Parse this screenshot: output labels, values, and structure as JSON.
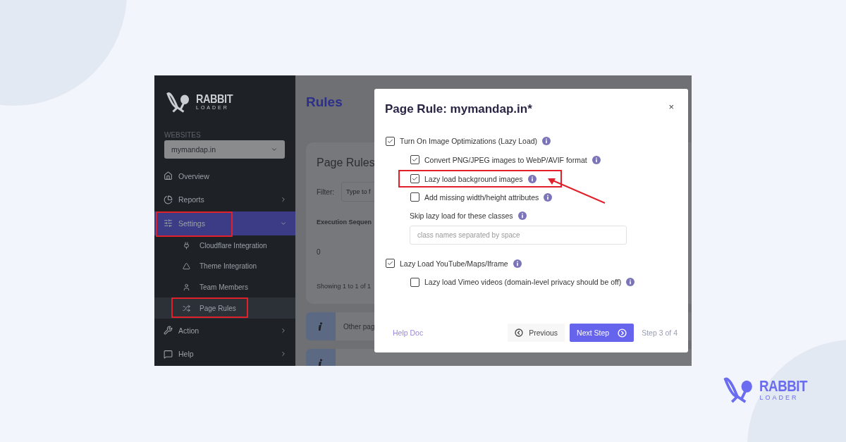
{
  "sidebar": {
    "logo": {
      "name": "RABBIT",
      "tagline": "LOADER"
    },
    "websites_label": "WEBSITES",
    "website_select": "mymandap.in",
    "items": [
      {
        "kind": "home",
        "label": "Overview",
        "selected": false,
        "highlighted": false,
        "has_submenu": false
      },
      {
        "kind": "reports",
        "label": "Reports",
        "selected": false,
        "highlighted": false,
        "has_submenu": true,
        "expanded": false
      },
      {
        "kind": "settings",
        "label": "Settings",
        "selected": true,
        "highlighted": true,
        "has_submenu": true,
        "expanded": true,
        "children": [
          {
            "kind": "cloudflare",
            "label": "Cloudflare Integration",
            "selected": false,
            "highlighted": false
          },
          {
            "kind": "theme",
            "label": "Theme Integration",
            "selected": false,
            "highlighted": false
          },
          {
            "kind": "team",
            "label": "Team Members",
            "selected": false,
            "highlighted": false
          },
          {
            "kind": "rules",
            "label": "Page Rules",
            "selected": true,
            "highlighted": true
          }
        ]
      },
      {
        "kind": "action",
        "label": "Action",
        "selected": false,
        "highlighted": false,
        "has_submenu": true,
        "expanded": false
      },
      {
        "kind": "help",
        "label": "Help",
        "selected": false,
        "highlighted": false,
        "has_submenu": true,
        "expanded": false
      }
    ]
  },
  "main": {
    "title": "Rules",
    "card": {
      "title": "Page Rules",
      "filter_label": "Filter:",
      "filter_placeholder": "Type to f",
      "column": "Execution Sequen",
      "cell": "0",
      "footer": "Showing 1 to 1 of 1"
    },
    "notices": [
      {
        "kind": "text",
        "text": "Other pag"
      },
      {
        "kind": "cut"
      }
    ]
  },
  "dialog": {
    "title": "Page Rule: mymandap.in*",
    "close": "×",
    "sections": [
      {
        "label": "Turn On Image Optimizations (Lazy Load)",
        "checked": true,
        "children": [
          {
            "kind": "checkbox",
            "label": "Convert PNG/JPEG images to WebP/AVIF format",
            "checked": true,
            "highlighted": false
          },
          {
            "kind": "checkbox",
            "label": "Lazy load background images",
            "checked": true,
            "highlighted": true
          },
          {
            "kind": "checkbox",
            "label": "Add missing width/height attributes",
            "checked": false,
            "highlighted": false
          },
          {
            "kind": "field",
            "label": "Skip lazy load for these classes",
            "placeholder": "class names separated by space"
          }
        ]
      },
      {
        "label": "Lazy Load YouTube/Maps/Iframe",
        "checked": true,
        "children": [
          {
            "kind": "checkbox",
            "label": "Lazy load Vimeo videos (domain-level privacy should be off)",
            "checked": false,
            "highlighted": false
          }
        ]
      }
    ],
    "help_link": "Help Doc",
    "previous": "Previous",
    "next": "Next Step",
    "step": "Step 3 of 4"
  },
  "brand": {
    "name": "RABBIT",
    "tagline": "LOADER"
  }
}
